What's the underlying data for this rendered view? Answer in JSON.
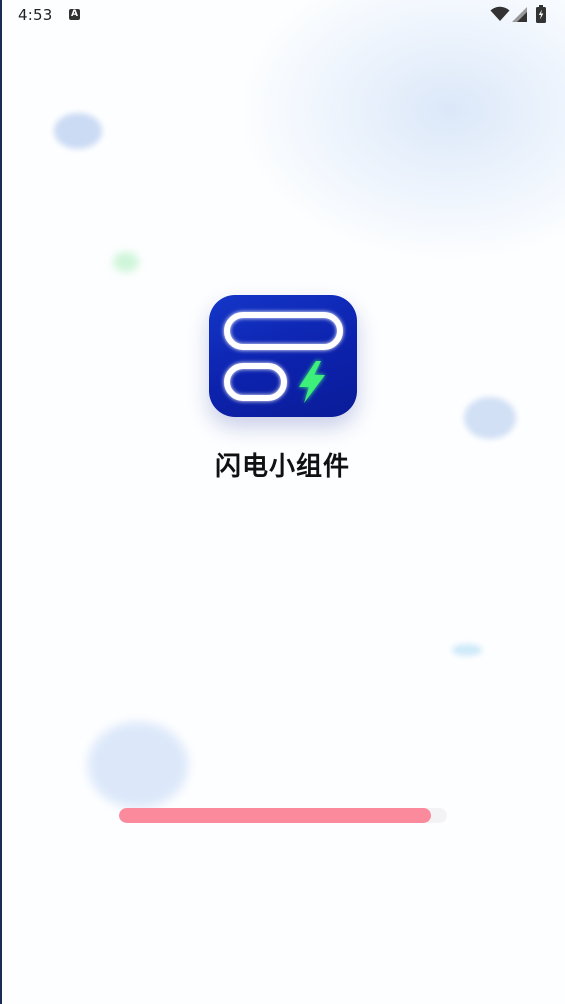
{
  "status_bar": {
    "time": "4:53",
    "notification_icon": "a-icon",
    "wifi_icon": "wifi-icon",
    "signal_icon": "signal-icon",
    "battery_icon": "battery-icon"
  },
  "app": {
    "name": "闪电小组件",
    "icon": "widget-lightning-icon",
    "icon_colors": {
      "background": "#0c22ad",
      "outline": "#ffffff",
      "bolt": "#3ef07a"
    }
  },
  "loading": {
    "progress_percent": 95,
    "fill_color": "#fb8a9c",
    "track_color": "#f3f3f5"
  }
}
